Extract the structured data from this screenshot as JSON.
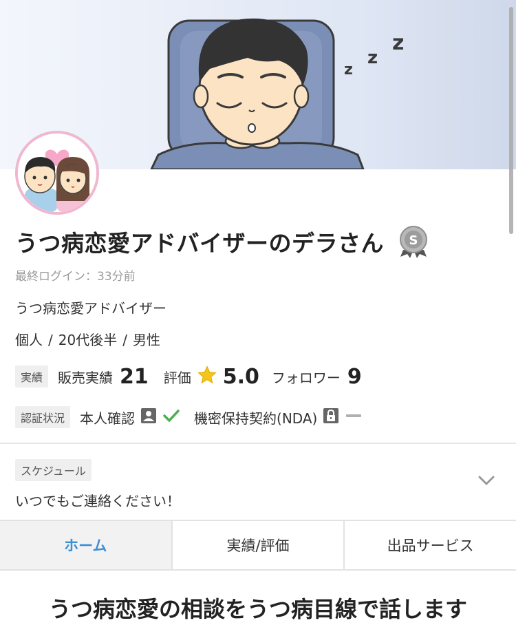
{
  "banner": {
    "zzz": [
      "z",
      "z",
      "z"
    ]
  },
  "profile": {
    "name": "うつ病恋愛アドバイザーのデラさん",
    "rank_badge_letter": "S",
    "last_login": "最終ログイン：33分前",
    "title": "うつ病恋愛アドバイザー",
    "info": {
      "type": "個人",
      "age": "20代後半",
      "gender": "男性",
      "separator": "/"
    }
  },
  "stats": {
    "tag": "実績",
    "sales_label": "販売実績",
    "sales_value": "21",
    "rating_label": "評価",
    "rating_value": "5.0",
    "followers_label": "フォロワー",
    "followers_value": "9"
  },
  "verification": {
    "tag": "認証状況",
    "identity_label": "本人確認",
    "nda_label": "機密保持契約(NDA)"
  },
  "schedule": {
    "tag": "スケジュール",
    "text": "いつでもご連絡ください！"
  },
  "tabs": [
    {
      "label": "ホーム",
      "active": true
    },
    {
      "label": "実績/評価",
      "active": false
    },
    {
      "label": "出品サービス",
      "active": false
    }
  ],
  "headline": "うつ病恋愛の相談をうつ病目線で話します",
  "colors": {
    "accent": "#3b8fd6",
    "check": "#4caf50",
    "avatar_ring": "#f0b7cf",
    "star": "#f5c518"
  }
}
